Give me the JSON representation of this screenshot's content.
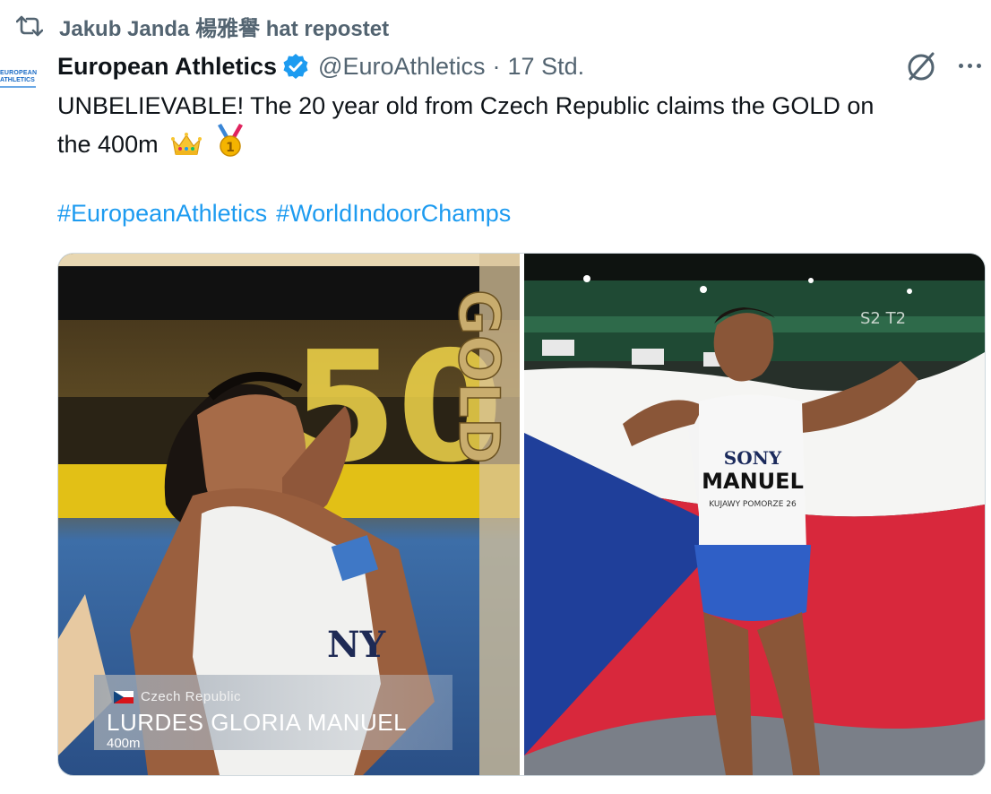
{
  "repost": {
    "icon": "repost-icon",
    "text": "Jakub Janda 楊雅譽 hat repostet"
  },
  "author": {
    "avatar_line1": "EUROPEAN",
    "avatar_line2": "ATHLETICS",
    "display_name": "European Athletics",
    "verified_icon": "verified-badge-icon",
    "handle": "@EuroAthletics",
    "separator": "·",
    "time": "17 Std."
  },
  "actions": {
    "grok_icon": "grok-icon",
    "more_icon": "more-icon"
  },
  "tweet": {
    "line1": "UNBELIEVABLE! The 20 year old from Czech Republic claims the GOLD on",
    "line2": "the 400m",
    "emojis": [
      "crown-emoji",
      "gold-medal-emoji"
    ],
    "hashtags": [
      "#EuropeanAthletics",
      "#WorldIndoorChamps"
    ]
  },
  "media": {
    "left": {
      "banner": "GOLD",
      "scoreboard": "50",
      "bib": "NY",
      "country": "Czech Republic",
      "athlete": "LURDES GLORIA MANUEL",
      "event": "400m"
    },
    "right": {
      "sponsor": "SONY",
      "bib_name": "MANUEL",
      "bib_sub": "KUJAWY POMORZE 26",
      "zone_sign": "S2  T2"
    }
  },
  "colors": {
    "link": "#1d9bf0",
    "muted": "#536471",
    "text": "#0f1419",
    "verified": "#1d9bf0"
  }
}
